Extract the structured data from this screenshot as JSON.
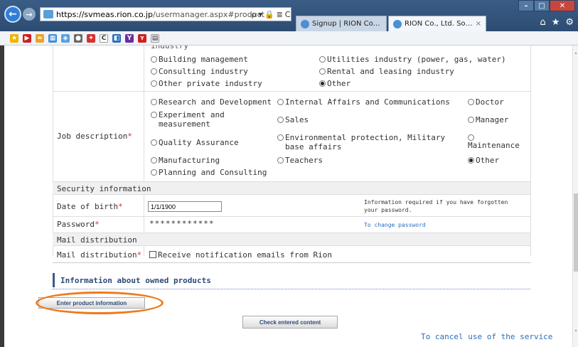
{
  "browser": {
    "url_host": "https://svmeas.rion.co.jp",
    "url_rest": "/usermanager.aspx#product",
    "address_tools": [
      "ρ",
      "▾",
      "🔒",
      "≣",
      "C"
    ],
    "tabs": [
      {
        "label": "Signup | RION Co., Ltd. So...",
        "active": false
      },
      {
        "label": "RION Co., Ltd. Sound Le...",
        "active": true,
        "close": "×"
      }
    ],
    "window_controls": {
      "minimize": "–",
      "maximize": "□",
      "close": "✕"
    },
    "corner_icons": [
      "⌂",
      "★",
      "⚙"
    ],
    "back": "←",
    "forward": "→"
  },
  "industry": {
    "cut_label": "industry",
    "options": [
      {
        "label": "Building management",
        "checked": false
      },
      {
        "label": "Utilities industry (power, gas, water)",
        "checked": false
      },
      {
        "label": "Consulting industry",
        "checked": false
      },
      {
        "label": "Rental and leasing industry",
        "checked": false
      },
      {
        "label": "Other private industry",
        "checked": false
      },
      {
        "label": "Other",
        "checked": true
      }
    ]
  },
  "job": {
    "label": "Job description",
    "required_mark": "*",
    "options": [
      {
        "label": "Research and Development",
        "checked": false
      },
      {
        "label": "Internal Affairs and Communications",
        "checked": false
      },
      {
        "label": "Doctor",
        "checked": false
      },
      {
        "label": "Experiment and measurement",
        "checked": false
      },
      {
        "label": "Sales",
        "checked": false
      },
      {
        "label": "Manager",
        "checked": false
      },
      {
        "label": "Quality Assurance",
        "checked": false
      },
      {
        "label": "Environmental protection, Military base affairs",
        "checked": false
      },
      {
        "label": "Maintenance",
        "checked": false
      },
      {
        "label": "Manufacturing",
        "checked": false
      },
      {
        "label": "Teachers",
        "checked": false
      },
      {
        "label": "Other",
        "checked": true
      },
      {
        "label": "Planning and Consulting",
        "checked": false
      }
    ]
  },
  "security": {
    "section_title": "Security information",
    "dob_label": "Date of birth",
    "dob_value": "1/1/1900",
    "dob_note": "Information required if you have forgotten your password.",
    "password_label": "Password",
    "password_value": "************",
    "change_password_link": "To change password",
    "required_mark": "*"
  },
  "mail": {
    "section_title": "Mail distribution",
    "label": "Mail distribution",
    "required_mark": "*",
    "checkbox_label": "Receive notification emails from Rion",
    "checked": false
  },
  "products": {
    "title": "Information about owned products",
    "enter_button": "Enter product information"
  },
  "footer": {
    "check_button": "Check entered content",
    "cancel_link": "To cancel use of the service"
  },
  "colors": {
    "highlight_ring": "#ee7a1c",
    "link": "#2a6ebb",
    "required": "#d43232",
    "section_bg": "#f0f0f0"
  }
}
